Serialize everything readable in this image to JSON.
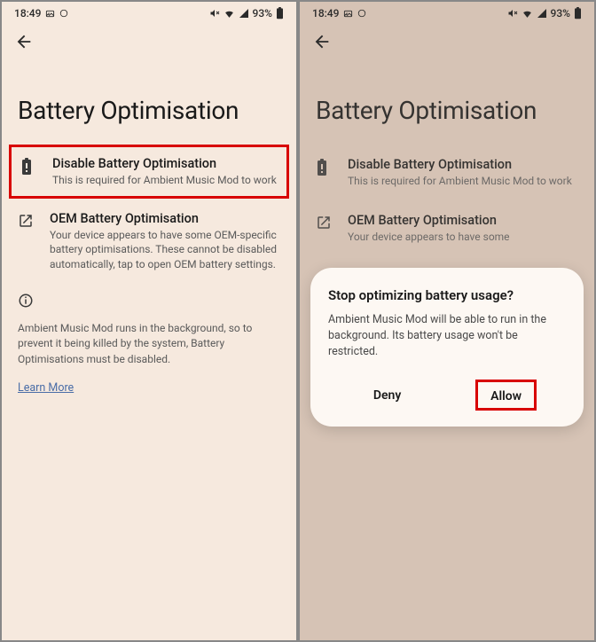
{
  "status": {
    "time": "18:49",
    "battery_pct": "93%"
  },
  "page": {
    "title": "Battery Optimisation"
  },
  "items": {
    "disable": {
      "title": "Disable Battery Optimisation",
      "sub": "This is required for Ambient Music Mod to work"
    },
    "oem": {
      "title": "OEM Battery Optimisation",
      "sub": "Your device appears to have some OEM-specific battery optimisations. These cannot be disabled automatically, tap to open OEM battery settings."
    },
    "oem_truncated": {
      "sub": "Your device appears to have some"
    }
  },
  "info": {
    "text": "Ambient Music Mod runs in the background, so to prevent it being killed by the system, Battery Optimisations must be disabled."
  },
  "learn_more": "Learn More",
  "dialog": {
    "title": "Stop optimizing battery usage?",
    "text": "Ambient Music Mod will be able to run in the background. Its battery usage won't be restricted.",
    "deny": "Deny",
    "allow": "Allow"
  }
}
